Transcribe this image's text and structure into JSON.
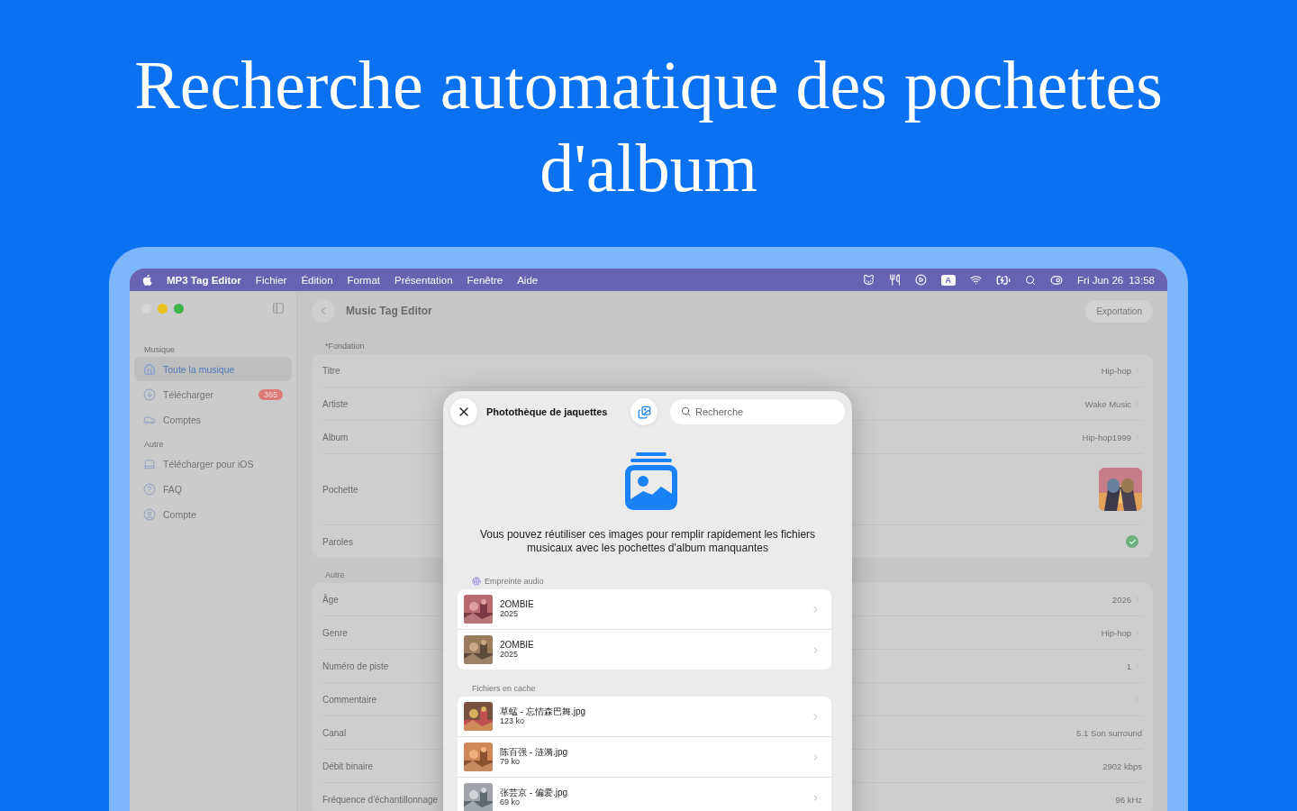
{
  "headline": "Recherche automatique des pochettes d'album",
  "menu_bar": {
    "app_name": "MP3 Tag Editor",
    "menus": [
      "Fichier",
      "Édition",
      "Format",
      "Présentation",
      "Fenêtre",
      "Aide"
    ],
    "input_source": "A",
    "date": "Fri Jun 26",
    "time": "13:58"
  },
  "sidebar": {
    "sections": [
      {
        "title": "Musique",
        "items": [
          {
            "label": "Toute la musique",
            "kind": "home",
            "selected": true
          },
          {
            "label": "Télécharger",
            "kind": "download",
            "selected": false,
            "badge": "365"
          },
          {
            "label": "Comptes",
            "kind": "car",
            "selected": false
          }
        ]
      },
      {
        "title": "Autre",
        "items": [
          {
            "label": "Télécharger pour iOS",
            "kind": "devices",
            "selected": false
          },
          {
            "label": "FAQ",
            "kind": "help",
            "selected": false
          },
          {
            "label": "Compte",
            "kind": "user",
            "selected": false
          }
        ]
      }
    ]
  },
  "toolbar": {
    "title": "Music Tag Editor",
    "export_button": "Exportation"
  },
  "form": {
    "sections": [
      {
        "title": "*Fondation",
        "rows": [
          {
            "label": "Titre",
            "kind": "text",
            "value": "Hip-hop",
            "chevron": true
          },
          {
            "label": "Artiste",
            "kind": "text",
            "value": "Wake Music",
            "chevron": true
          },
          {
            "label": "Album",
            "kind": "text",
            "value": "Hip-hop1999",
            "chevron": true
          },
          {
            "label": "Pochette",
            "kind": "artwork"
          },
          {
            "label": "Paroles",
            "kind": "check",
            "checked": true
          }
        ]
      },
      {
        "title": "Autre",
        "rows": [
          {
            "label": "Âge",
            "kind": "text",
            "value": "2026",
            "chevron": true
          },
          {
            "label": "Genre",
            "kind": "text",
            "value": "Hip-hop",
            "chevron": true
          },
          {
            "label": "Numéro de piste",
            "kind": "text",
            "value": "1",
            "chevron": true
          },
          {
            "label": "Commentaire",
            "kind": "text",
            "chevron": true
          },
          {
            "label": "Canal",
            "kind": "text",
            "value": "5.1 Son surround",
            "chevron": false
          },
          {
            "label": "Débit binaire",
            "kind": "text",
            "value": "2902 kbps",
            "chevron": false
          },
          {
            "label": "Fréquence d'échantillonnage",
            "kind": "text",
            "value": "96 kHz",
            "chevron": false
          }
        ]
      }
    ]
  },
  "modal": {
    "title": "Photothèque de jaquettes",
    "search": {
      "placeholder": "Recherche"
    },
    "message": "Vous pouvez réutiliser ces images pour remplir rapidement les fichiers musicaux avec les pochettes d'album manquantes",
    "sections": [
      {
        "title": "Empreinte audio",
        "kind": "fingerprint",
        "items": [
          {
            "title": "2OMBIE",
            "subtitle": "2025"
          },
          {
            "title": "2OMBIE",
            "subtitle": "2025"
          }
        ]
      },
      {
        "title": "Fichiers en cache",
        "kind": "cache",
        "items": [
          {
            "title": "草蜢 - 忘情森巴舞.jpg",
            "subtitle": "123 ko"
          },
          {
            "title": "陈百强 - 涟漪.jpg",
            "subtitle": "79 ko"
          },
          {
            "title": "张芸京 - 偏爱.jpg",
            "subtitle": "69 ko"
          }
        ]
      }
    ]
  }
}
